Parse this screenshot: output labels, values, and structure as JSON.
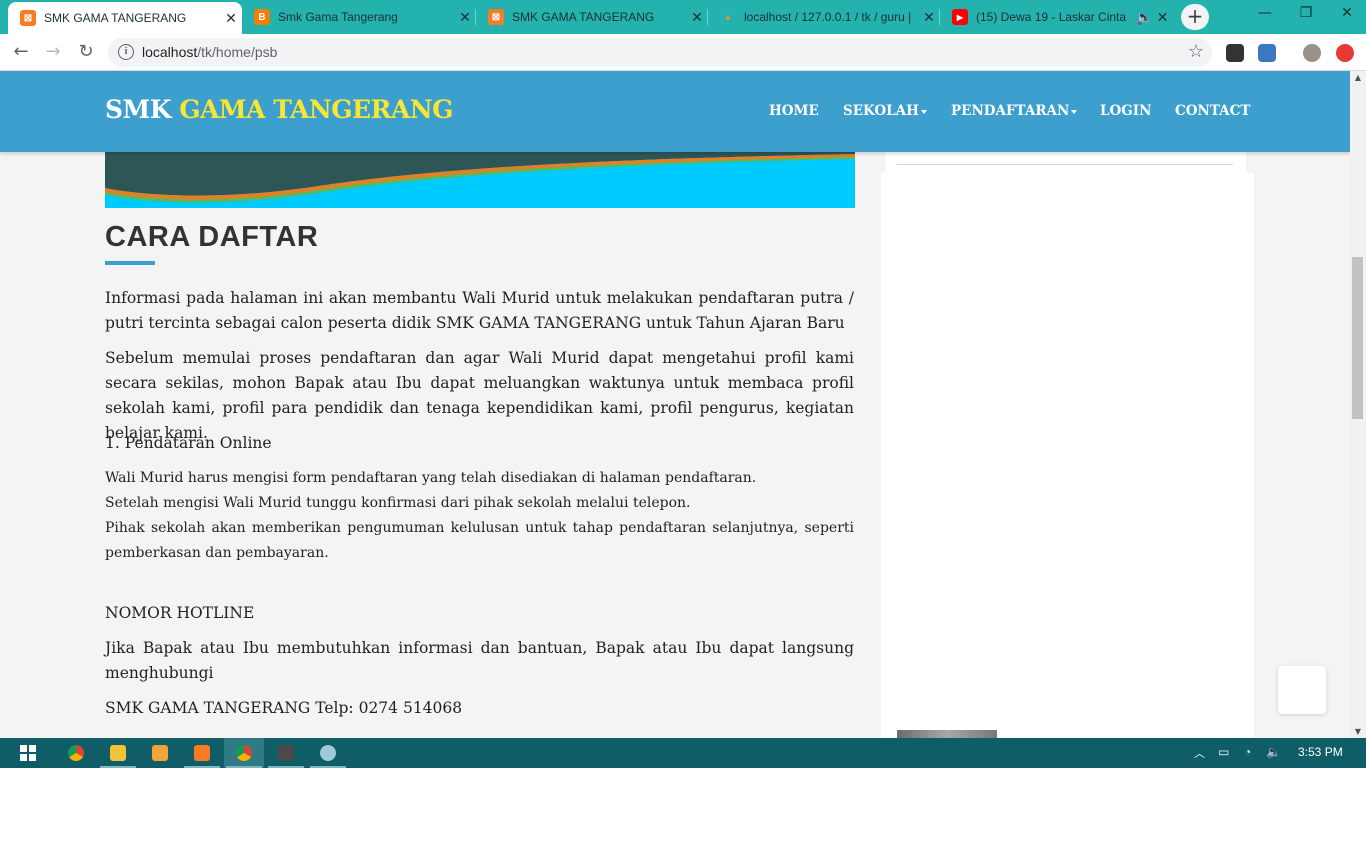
{
  "browser": {
    "tabs": [
      {
        "title": "SMK GAMA TANGERANG",
        "icon": "xampp-icon",
        "color": "#fb7a24",
        "active": true
      },
      {
        "title": "Smk Gama Tangerang",
        "icon": "blogger-icon",
        "color": "#f57d00",
        "active": false
      },
      {
        "title": "SMK GAMA TANGERANG",
        "icon": "xampp-icon",
        "color": "#fb7a24",
        "active": false
      },
      {
        "title": "localhost / 127.0.0.1 / tk / guru |",
        "icon": "phpmyadmin-icon",
        "color": "#e98e2e",
        "active": false
      },
      {
        "title": "(15) Dewa 19 - Laskar Cinta",
        "icon": "youtube-icon",
        "color": "#ff0000",
        "active": false
      }
    ],
    "url_host": "localhost",
    "url_path": "/tk/home/psb"
  },
  "site": {
    "brand_first": "SMK",
    "brand_second": "GAMA TANGERANG",
    "nav": {
      "home": "HOME",
      "sekolah": "SEKOLAH",
      "pendaftaran": "PENDAFTARAN",
      "login": "LOGIN",
      "contact": "CONTACT"
    },
    "accent": "#3d9fcd",
    "brand_highlight": "#f7e733"
  },
  "content": {
    "title": "CARA DAFTAR",
    "para1": "Informasi pada halaman ini akan membantu Wali Murid untuk melakukan pendaftaran putra / putri tercinta sebagai calon peserta didik SMK GAMA TANGERANG untuk Tahun Ajaran Baru",
    "para2": "Sebelum memulai proses pendaftaran dan agar Wali Murid dapat mengetahui profil kami secara sekilas, mohon Bapak atau Ibu dapat meluangkan waktunya untuk membaca profil sekolah kami, profil para pendidik dan tenaga kependidikan kami, profil pengurus, kegiatan belajar kami.",
    "step_heading": "1. Pendataran Online",
    "step_line1": "Wali Murid harus mengisi form pendaftaran yang telah disediakan di halaman pendaftaran.",
    "step_line2": "Setelah mengisi Wali Murid tunggu konfirmasi dari pihak sekolah melalui telepon.",
    "step_line3": "Pihak sekolah akan memberikan pengumuman kelulusan untuk tahap pendaftaran selanjutnya, seperti pemberkasan dan pembayaran.",
    "hotline_heading": "NOMOR HOTLINE",
    "hotline_text": "Jika Bapak atau Ibu membutuhkan informasi dan bantuan, Bapak atau Ibu dapat langsung menghubungi",
    "hotline_phone": "SMK GAMA TANGERANG Telp: 0274 514068"
  },
  "taskbar": {
    "time": "3:53 PM",
    "apps": [
      "windows-start-icon",
      "chrome-icon",
      "file-explorer-icon",
      "media-player-icon",
      "xampp-icon",
      "chrome-icon",
      "sublime-text-icon",
      "app-icon"
    ]
  }
}
